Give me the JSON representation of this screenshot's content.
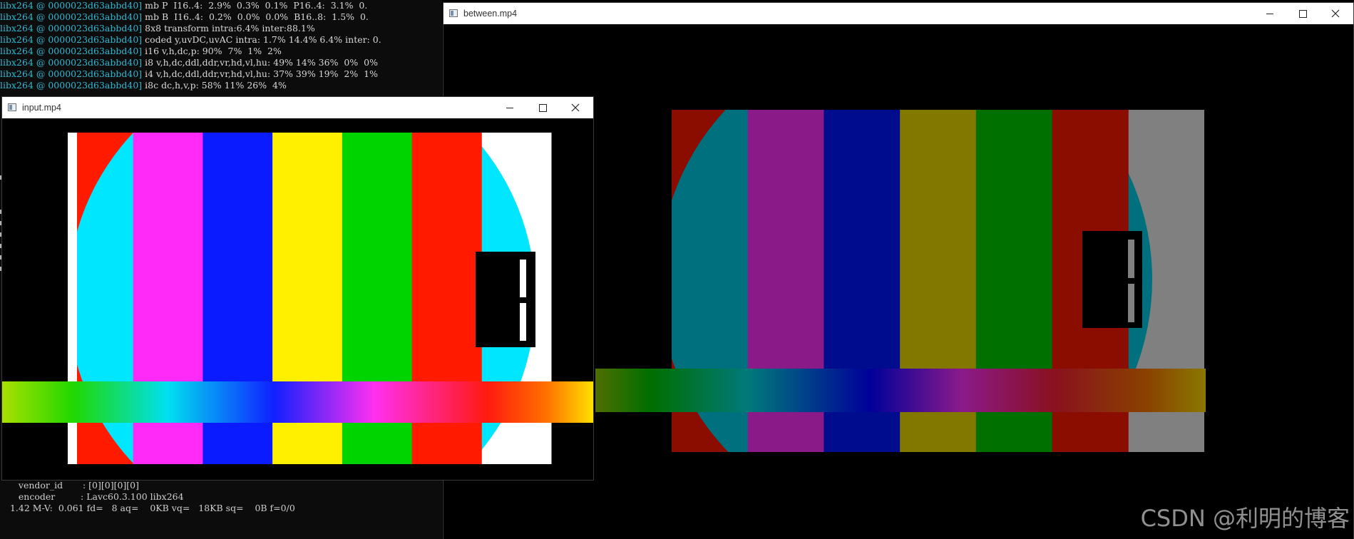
{
  "console": {
    "log_lines": [
      {
        "prefix": "libx264 @ 0000023d63abbd40]",
        "text": " mb P  I16..4:  2.9%  0.3%  0.1%  P16..4:  3.1%  0."
      },
      {
        "prefix": "libx264 @ 0000023d63abbd40]",
        "text": " mb B  I16..4:  0.2%  0.0%  0.0%  B16..8:  1.5%  0."
      },
      {
        "prefix": "libx264 @ 0000023d63abbd40]",
        "text": " 8x8 transform intra:6.4% inter:88.1%"
      },
      {
        "prefix": "libx264 @ 0000023d63abbd40]",
        "text": " coded y,uvDC,uvAC intra: 1.7% 14.4% 6.4% inter: 0."
      },
      {
        "prefix": "libx264 @ 0000023d63abbd40]",
        "text": " i16 v,h,dc,p: 90%  7%  1%  2%"
      },
      {
        "prefix": "libx264 @ 0000023d63abbd40]",
        "text": " i8 v,h,dc,ddl,ddr,vr,hd,vl,hu: 49% 14% 36%  0%  0%"
      },
      {
        "prefix": "libx264 @ 0000023d63abbd40]",
        "text": " i4 v,h,dc,ddl,ddr,vr,hd,vl,hu: 37% 39% 19%  2%  1%"
      },
      {
        "prefix": "libx264 @ 0000023d63abbd40]",
        "text": " i8c dc,h,v,p: 58% 11% 26%  4%"
      }
    ],
    "bottom_lines": [
      "    vendor_id       : [0][0][0][0]",
      "    encoder         : Lavc60.3.100 libx264",
      " 1.42 M-V:  0.061 fd=   8 aq=    0KB vq=   18KB sq=    0B f=0/0"
    ]
  },
  "windows": {
    "input": {
      "title": "input.mp4",
      "controls": {
        "minimize": "minimize",
        "maximize": "maximize",
        "close": "close"
      }
    },
    "between": {
      "title": "between.mp4",
      "controls": {
        "minimize": "minimize",
        "maximize": "maximize",
        "close": "close"
      }
    }
  },
  "test_pattern_colors": {
    "input": [
      "#ff1a00",
      "#ff2af8",
      "#0a1cff",
      "#fff000",
      "#00d400",
      "#ff1a00",
      "#ffffff"
    ],
    "input_circle": "#00e6ff",
    "between": [
      "#8a0d00",
      "#8a1a88",
      "#000c8e",
      "#827800",
      "#007000",
      "#8a0d00",
      "#808080"
    ],
    "between_circle": "#00707e"
  },
  "watermark": "CSDN @利明的博客"
}
